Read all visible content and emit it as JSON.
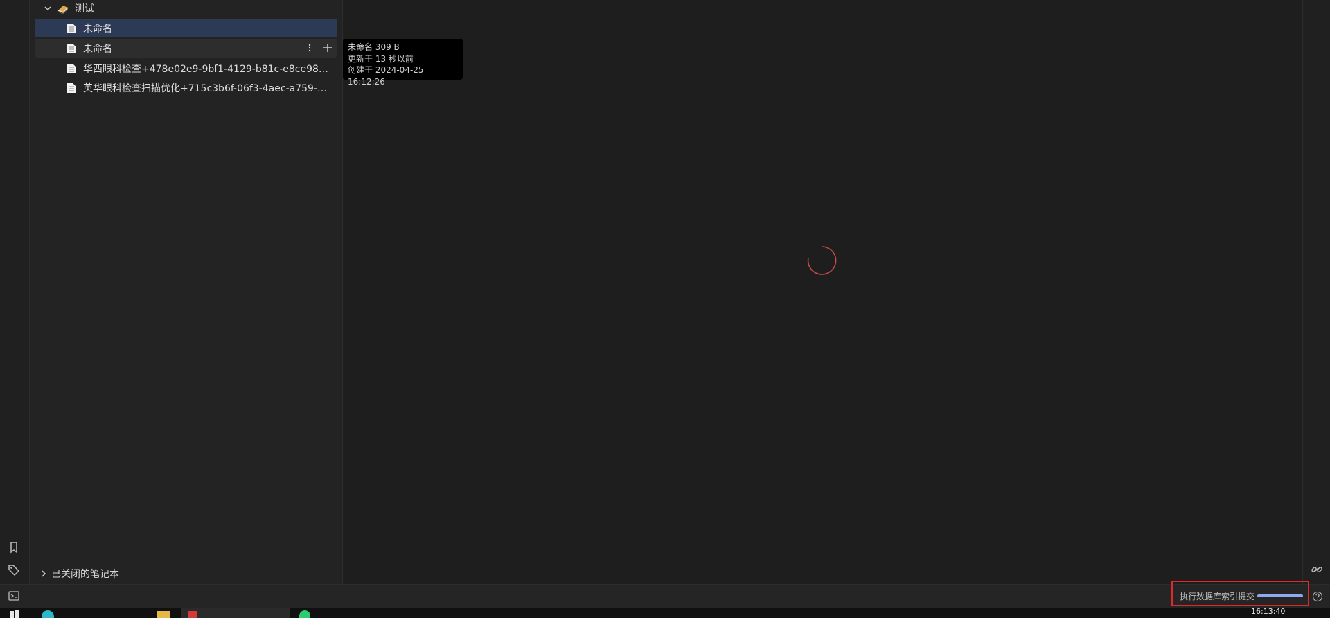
{
  "notebook": {
    "name": "测试"
  },
  "docs": [
    {
      "title": "未命名"
    },
    {
      "title": "未命名"
    },
    {
      "title": "华西眼科检查+478e02e9-9bf1-4129-b81c-e8ce985b..."
    },
    {
      "title": "英华眼科检查扫描优化+715c3b6f-06f3-4aec-a759-28..."
    }
  ],
  "tooltip": {
    "line1": "未命名 309 B",
    "line2": "更新于 13 秒以前",
    "line3": "创建于 2024-04-25 16:12:26"
  },
  "closed_notebooks_label": "已关闭的笔记本",
  "status": {
    "text": "执行数据库索引提交",
    "progress": 1.0
  },
  "taskbar": {
    "time": "16:13:40"
  },
  "colors": {
    "selected": "#2d3a55",
    "accent": "#8fa8f0",
    "highlight_box": "#e02a2a",
    "spinner": "#c94a4a"
  }
}
